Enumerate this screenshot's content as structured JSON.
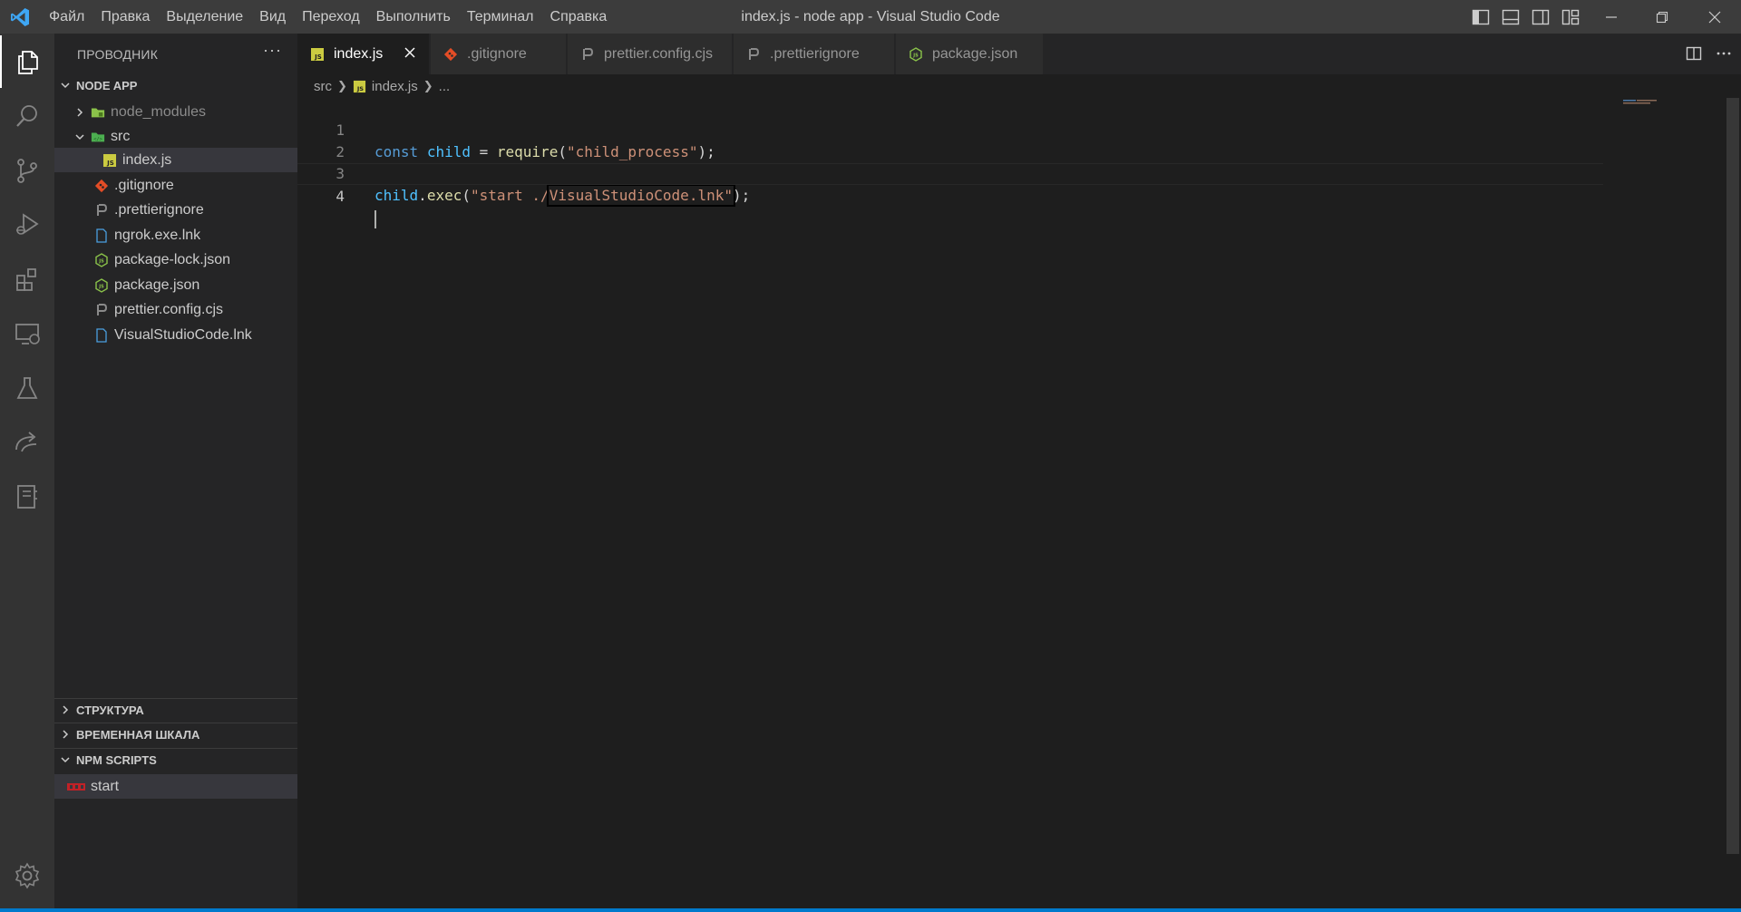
{
  "window": {
    "title": "index.js - node app - Visual Studio Code",
    "menu": [
      "Файл",
      "Правка",
      "Выделение",
      "Вид",
      "Переход",
      "Выполнить",
      "Терминал",
      "Справка"
    ]
  },
  "activity_bar": {
    "items": [
      "explorer-icon",
      "search-icon",
      "source-control-icon",
      "run-debug-icon",
      "extensions-icon",
      "remote-explorer-icon",
      "testing-icon",
      "live-share-icon",
      "notebook-icon"
    ],
    "bottom": [
      "gear-icon"
    ]
  },
  "sidebar": {
    "title": "ПРОВОДНИК",
    "more": "···",
    "project": {
      "name": "NODE APP",
      "items": [
        {
          "label": "node_modules",
          "type": "folder",
          "expanded": false
        },
        {
          "label": "src",
          "type": "folder",
          "expanded": true
        },
        {
          "label": "index.js",
          "type": "js",
          "selected": true
        },
        {
          "label": ".gitignore",
          "type": "git"
        },
        {
          "label": ".prettierignore",
          "type": "prettier"
        },
        {
          "label": "ngrok.exe.lnk",
          "type": "file"
        },
        {
          "label": "package-lock.json",
          "type": "node"
        },
        {
          "label": "package.json",
          "type": "node"
        },
        {
          "label": "prettier.config.cjs",
          "type": "prettier"
        },
        {
          "label": "VisualStudioCode.lnk",
          "type": "file"
        }
      ]
    },
    "sections": {
      "outline": "СТРУКТУРА",
      "timeline": "ВРЕМЕННАЯ ШКАЛА",
      "npm": "NPM SCRIPTS"
    },
    "npm_scripts": [
      {
        "label": "start"
      }
    ]
  },
  "tabs": [
    {
      "label": "index.js",
      "active": true
    },
    {
      "label": ".gitignore"
    },
    {
      "label": "prettier.config.cjs"
    },
    {
      "label": ".prettierignore"
    },
    {
      "label": "package.json"
    }
  ],
  "breadcrumb": [
    "src",
    "index.js",
    "..."
  ],
  "editor": {
    "line_numbers": [
      "1",
      "2",
      "3",
      "4"
    ],
    "line1": {
      "kw": "const",
      "var": "child",
      "op": " = ",
      "fn": "require",
      "open": "(",
      "str": "\"child_process\"",
      "close": ");"
    },
    "line3": {
      "obj": "child",
      "dot": ".",
      "fn": "exec",
      "open": "(",
      "str_a": "\"start ./",
      "str_b": "VisualStudioCode.lnk\"",
      "close": ");"
    }
  },
  "colors": {
    "activity_bar": "#333333",
    "sidebar": "#252526",
    "editor": "#1e1e1e",
    "title_bar": "#3c3c3c",
    "status_accent": "#007acc",
    "js_icon": "#cbcb41",
    "git_icon": "#e44d26",
    "node_icon": "#8bc34a"
  }
}
